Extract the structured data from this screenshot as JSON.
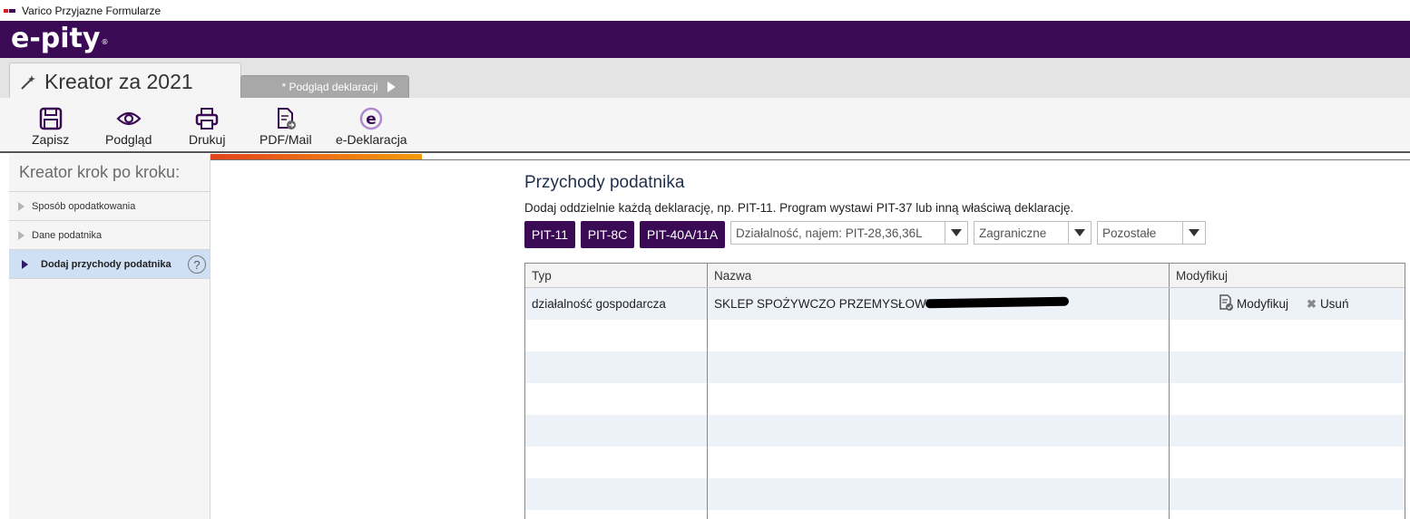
{
  "window": {
    "title": "Varico Przyjazne Formularze"
  },
  "brand": {
    "logo_text": "e-pity",
    "reg": "®"
  },
  "tabs": {
    "main": "Kreator za 2021",
    "preview": "* Podgląd deklaracji"
  },
  "toolbar": {
    "save": "Zapisz",
    "preview": "Podgląd",
    "print": "Drukuj",
    "pdf_mail": "PDF/Mail",
    "e_declaration": "e-Deklaracja"
  },
  "progress": {
    "value": 0.176
  },
  "sidebar": {
    "heading": "Kreator krok po kroku:",
    "items": [
      {
        "label": "Sposób opodatkowania"
      },
      {
        "label": "Dane podatnika"
      },
      {
        "label": "Dodaj przychody podatnika",
        "help": "?"
      }
    ]
  },
  "content": {
    "title": "Przychody podatnika",
    "description": "Dodaj oddzielnie każdą deklarację, np. PIT-11. Program wystawi PIT-37 lub inną właściwą deklarację.",
    "buttons": {
      "pit11": "PIT-11",
      "pit8c": "PIT-8C",
      "pit40a": "PIT-40A/11A"
    },
    "selects": {
      "business": "Działalność, najem: PIT-28,36,36L",
      "foreign": "Zagraniczne",
      "other": "Pozostałe"
    }
  },
  "table": {
    "headers": {
      "type": "Typ",
      "name": "Nazwa",
      "modify": "Modyfikuj"
    },
    "rows": [
      {
        "type": "działalność gospodarcza",
        "name": "SKLEP SPOŻYWCZO PRZEMYSŁOWY",
        "modify": "Modyfikuj",
        "delete": "Usuń"
      }
    ]
  },
  "colors": {
    "brand": "#3b0a54",
    "progress_start": "#e2431c",
    "progress_end": "#f59a0c",
    "active_item": "#cfe0f5"
  }
}
